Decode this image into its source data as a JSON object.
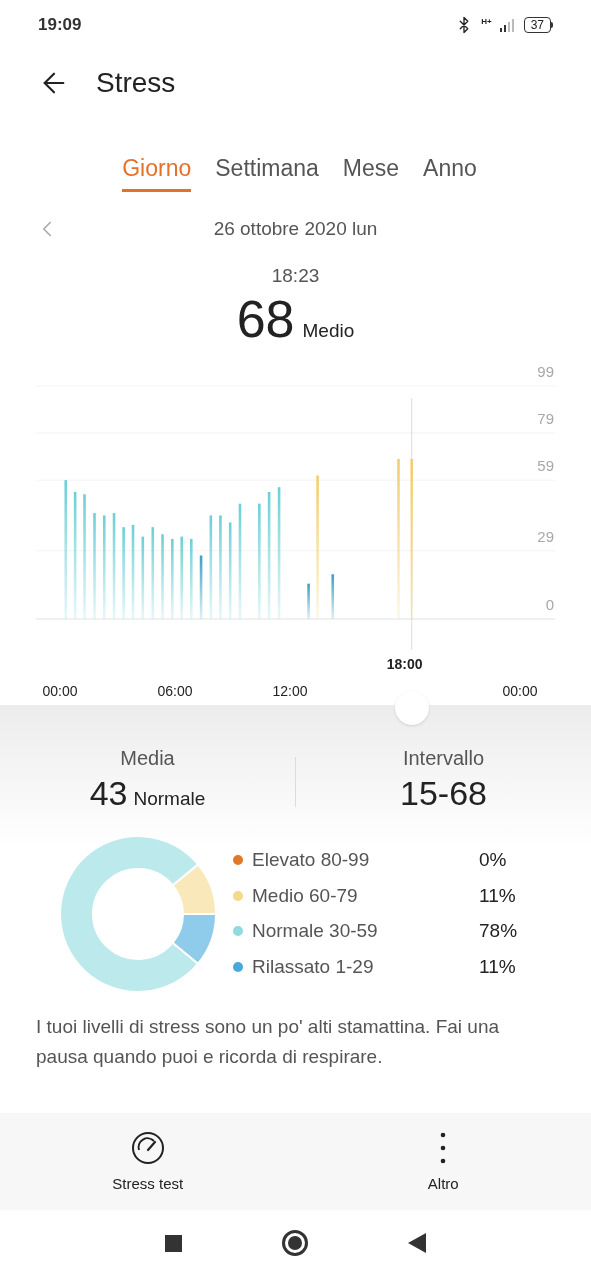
{
  "status_bar": {
    "time": "19:09",
    "network": "H+",
    "battery": "37"
  },
  "header": {
    "title": "Stress"
  },
  "tabs": [
    {
      "label": "Giorno",
      "selected": true
    },
    {
      "label": "Settimana",
      "selected": false
    },
    {
      "label": "Mese",
      "selected": false
    },
    {
      "label": "Anno",
      "selected": false
    }
  ],
  "date_nav": {
    "date": "26 ottobre 2020 lun"
  },
  "reading": {
    "time": "18:23",
    "value": "68",
    "level_label": "Medio"
  },
  "chart": {
    "chart_data": {
      "type": "bar",
      "x": [
        0.3,
        0.79,
        1.28,
        1.8,
        2.31,
        2.82,
        3.32,
        3.81,
        4.32,
        4.84,
        5.35,
        5.86,
        6.35,
        6.85,
        7.36,
        7.87,
        8.37,
        8.88,
        9.39,
        10.4,
        10.91,
        11.43,
        12.97,
        13.44,
        14.23,
        17.66,
        18.35
      ],
      "xlim": [
        0,
        24
      ],
      "ylim": [
        0,
        99
      ],
      "xticks": [
        {
          "value": 0,
          "label": "00:00"
        },
        {
          "value": 6,
          "label": "06:00"
        },
        {
          "value": 12,
          "label": "12:00"
        },
        {
          "value": 24,
          "label": "00:00"
        }
      ],
      "yticks": [
        0,
        29,
        59,
        79,
        99
      ],
      "grid": true,
      "series": [
        {
          "color": "#6ccfd7",
          "values": [
            59,
            54,
            53,
            45,
            44,
            45,
            39,
            40,
            35,
            39,
            36,
            34,
            35,
            34,
            null,
            44,
            44,
            41,
            49,
            49,
            54,
            56,
            null,
            null,
            null,
            null,
            null
          ]
        },
        {
          "color": "#3a9fc4",
          "values": [
            null,
            null,
            null,
            null,
            null,
            null,
            null,
            null,
            null,
            null,
            null,
            null,
            null,
            null,
            27,
            null,
            null,
            null,
            null,
            null,
            null,
            null,
            15,
            null,
            19,
            null,
            null
          ]
        },
        {
          "color": "#f2cd6c",
          "values": [
            null,
            null,
            null,
            null,
            null,
            null,
            null,
            null,
            null,
            null,
            null,
            null,
            null,
            null,
            null,
            null,
            null,
            null,
            null,
            null,
            null,
            null,
            null,
            61,
            null,
            68,
            68
          ]
        }
      ],
      "annotations": [
        {
          "x": 18.35,
          "text": "18:00"
        }
      ]
    }
  },
  "summary": [
    {
      "label": "Media",
      "value": "43",
      "qualifier": "Normale"
    },
    {
      "label": "Intervallo",
      "value": "15-68"
    }
  ],
  "distribution": {
    "chart_data": {
      "type": "donut",
      "categories": [
        "Elevato 80-99",
        "Medio 60-79",
        "Normale 30-59",
        "Rilassato 1-29"
      ],
      "values": [
        0,
        11,
        78,
        11
      ]
    },
    "legend": [
      {
        "percent": "0%",
        "color": "#e07a2a"
      },
      {
        "percent": "11%",
        "color": "#f5d98a"
      },
      {
        "percent": "78%",
        "color": "#8fdbe0"
      },
      {
        "percent": "11%",
        "color": "#45a9dc"
      }
    ]
  },
  "advice": "I tuoi livelli di stress sono un po' alti stamattina. Fai una pausa quando puoi e ricorda di respirare.",
  "actions": [
    {
      "label": "Stress test",
      "kind": "gauge"
    },
    {
      "label": "Altro",
      "kind": "more"
    }
  ]
}
